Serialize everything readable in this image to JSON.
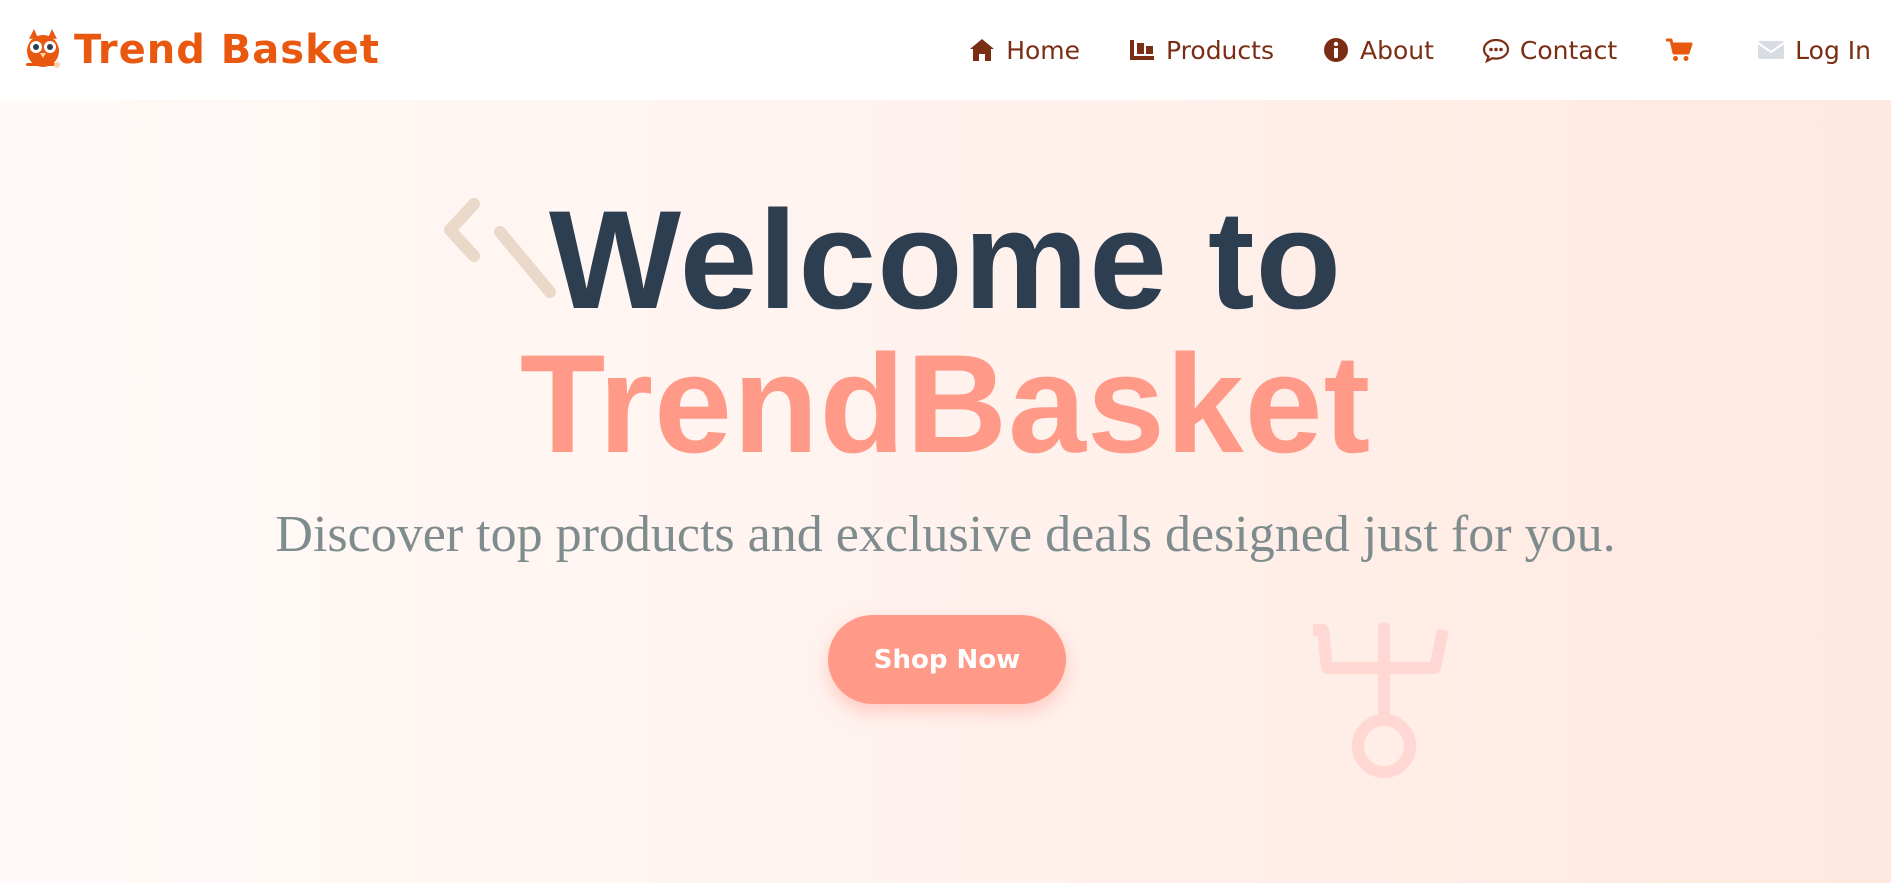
{
  "brand": {
    "name": "Trend Basket",
    "icon": "owl-logo-icon",
    "color": "#e8580f"
  },
  "nav": {
    "items": [
      {
        "label": "Home",
        "icon": "home-icon"
      },
      {
        "label": "Products",
        "icon": "products-icon"
      },
      {
        "label": "About",
        "icon": "info-icon"
      },
      {
        "label": "Contact",
        "icon": "chat-icon"
      },
      {
        "label": "",
        "icon": "cart-icon"
      },
      {
        "label": "Log In",
        "icon": "envelope-icon"
      }
    ],
    "text_color": "#7a2e14"
  },
  "hero": {
    "title_line1": "Welcome to",
    "title_line2": "TrendBasket",
    "subtitle": "Discover top products and exclusive deals designed just for you.",
    "cta_label": "Shop Now",
    "colors": {
      "title": "#2c3e50",
      "accent": "#ff9a88",
      "subtitle": "#7f8c8d"
    }
  }
}
